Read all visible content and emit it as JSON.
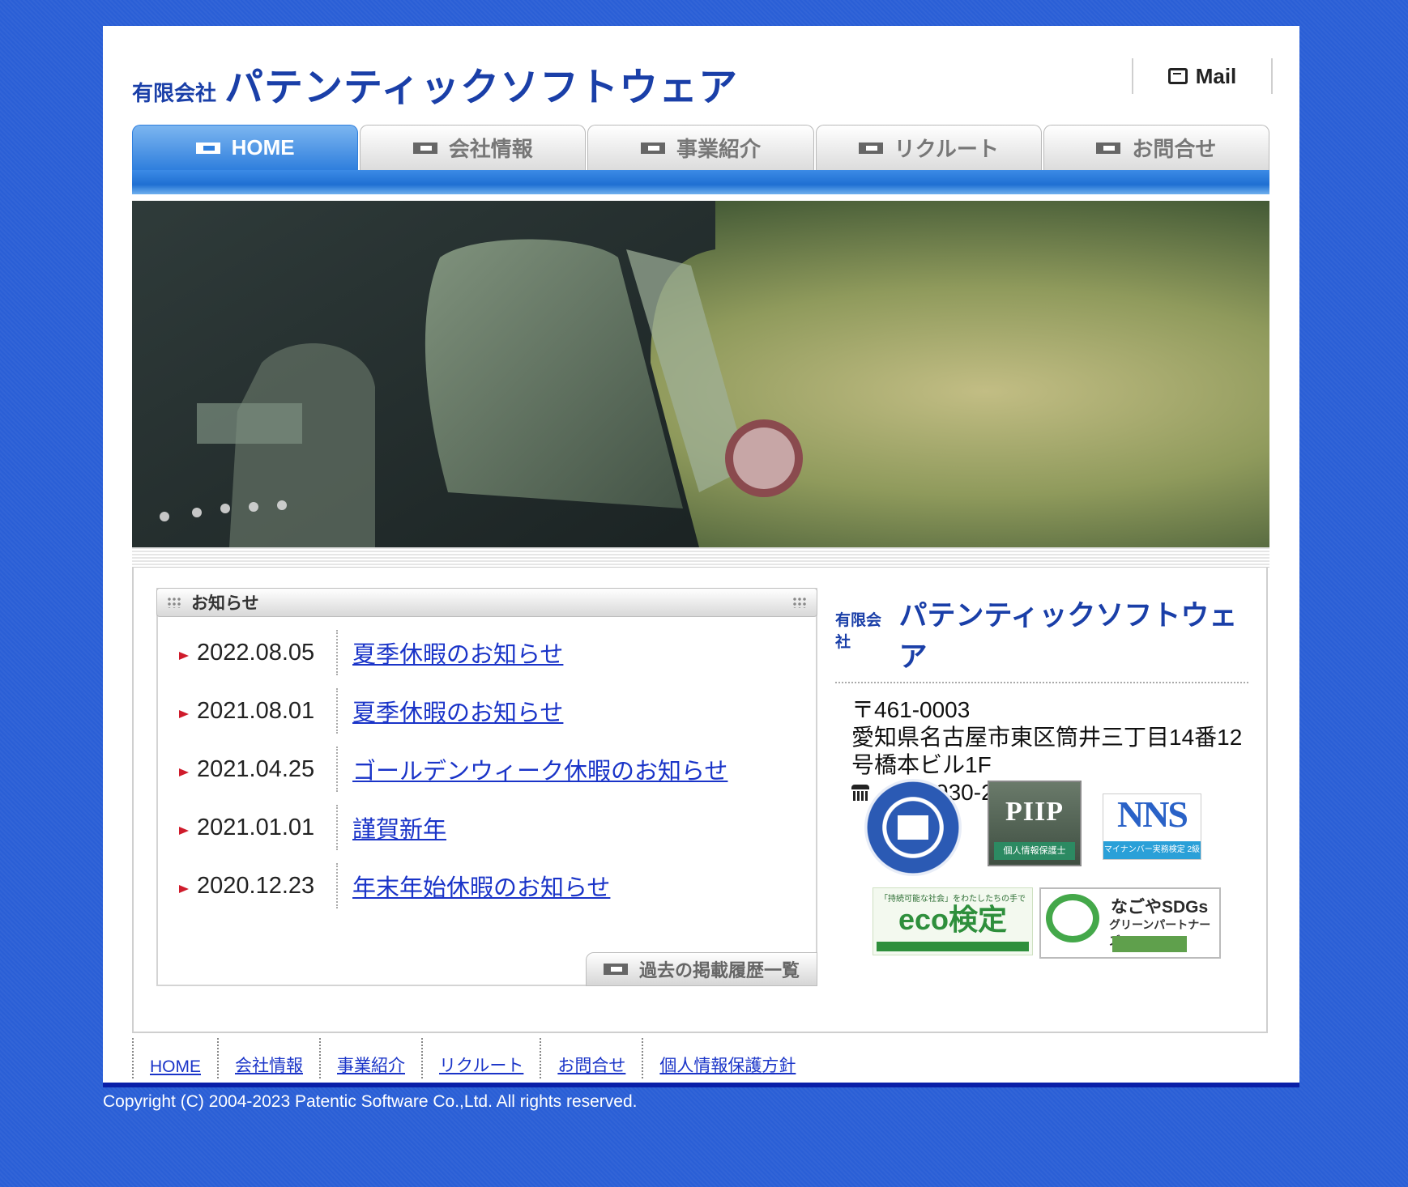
{
  "header": {
    "logo_small": "有限会社",
    "logo_big": "パテンティックソフトウェア",
    "mail_label": "Mail"
  },
  "nav": {
    "tabs": [
      {
        "label": "HOME",
        "active": true
      },
      {
        "label": "会社情報",
        "active": false
      },
      {
        "label": "事業紹介",
        "active": false
      },
      {
        "label": "リクルート",
        "active": false
      },
      {
        "label": "お問合せ",
        "active": false
      }
    ]
  },
  "news": {
    "title": "お知らせ",
    "items": [
      {
        "date": "2022.08.05",
        "title": "夏季休暇のお知らせ "
      },
      {
        "date": "2021.08.01",
        "title": "夏季休暇のお知らせ"
      },
      {
        "date": "2021.04.25",
        "title": "ゴールデンウィーク休暇のお知らせ"
      },
      {
        "date": "2021.01.01",
        "title": "謹賀新年"
      },
      {
        "date": "2020.12.23",
        "title": "年末年始休暇のお知らせ"
      }
    ],
    "archive_label": "過去の掲載履歴一覧"
  },
  "company": {
    "logo_small": "有限会社",
    "logo_big": "パテンティックソフトウェア",
    "postal": "〒461-0003",
    "address_line1": "愛知県名古屋市東区筒井三丁目14番12",
    "address_line2": "号橋本ビル1F",
    "phone": "052-930-2088"
  },
  "badges": {
    "piip_text": "PIIP",
    "piip_sub": "個人情報保護士",
    "nns_text": "NNS",
    "nns_sub": "マイナンバー実務検定 2級",
    "eco_header": "「持続可能な社会」をわたしたちの手で",
    "eco_text": "eco検定",
    "sdg_title": "なごやSDGs",
    "sdg_sub": "グリーンパートナーズ"
  },
  "footer": {
    "links": [
      "HOME",
      "会社情報",
      "事業紹介",
      "リクルート",
      "お問合せ",
      "個人情報保護方針"
    ],
    "copyright": "Copyright (C) 2004-2023 Patentic Software Co.,Ltd. All rights reserved."
  },
  "colors": {
    "background": "#2a5fd6",
    "accent": "#2f7fdd",
    "link": "#1a34c8",
    "news_arrow": "#cf1b2b"
  }
}
